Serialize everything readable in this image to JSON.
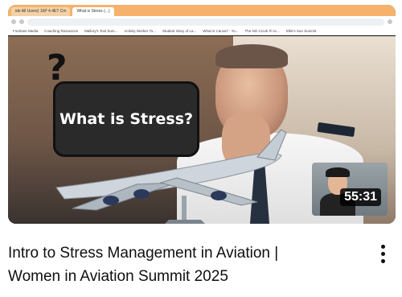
{
  "video": {
    "thumbnail_text": "What is Stress?",
    "question_mark": "?",
    "duration": "55:31",
    "title_line1": "Intro to Stress Management in Aviation |",
    "title_line2": "Women in Aviation Summit 2025"
  },
  "embedded_browser": {
    "tabs": [
      "ide All Users) 16P 4.4ET Cm",
      "What is Stress (...)"
    ],
    "bookmarks": [
      "Forelane Media",
      "Coaching Resources",
      "Mallory's Tool Sum...",
      "Activity Worker To...",
      "Student Story of La...",
      "What is Canva? : Yo...",
      "The NO CLUE R Ac...",
      "Ellie's Sun Summit"
    ]
  },
  "icons": {
    "menu": "more-vert-icon"
  },
  "colors": {
    "title_text": "#0f0f0f",
    "duration_bg": "#000000",
    "browser_tab_bar": "#f6b26b"
  }
}
